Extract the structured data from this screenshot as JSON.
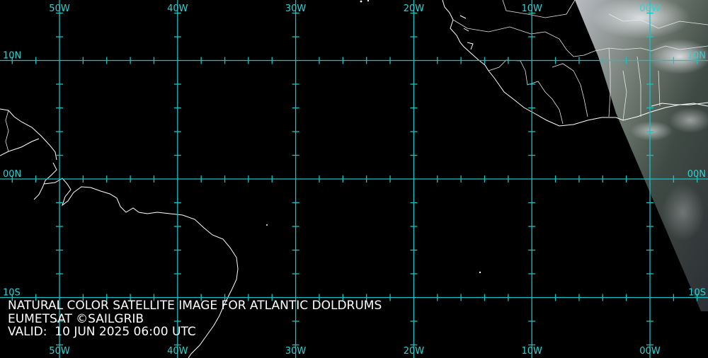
{
  "caption": {
    "title": "NATURAL COLOR SATELLITE IMAGE FOR ATLANTIC DOLDRUMS",
    "credit": "EUMETSAT ©SAILGRIB",
    "valid": "VALID:  10 JUN 2025 06:00 UTC"
  },
  "grid": {
    "longitudes": [
      {
        "deg": -50,
        "label": "50W"
      },
      {
        "deg": -40,
        "label": "40W"
      },
      {
        "deg": -30,
        "label": "30W"
      },
      {
        "deg": -20,
        "label": "20W"
      },
      {
        "deg": -10,
        "label": "10W"
      },
      {
        "deg": 0,
        "label": "00W"
      }
    ],
    "latitudes": [
      {
        "deg": 10,
        "label": "10N"
      },
      {
        "deg": 0,
        "label": "00N"
      },
      {
        "deg": -10,
        "label": "10S"
      }
    ],
    "line_color": "#19c2c2"
  },
  "colors": {
    "background": "#000000",
    "coastline": "#ffffff",
    "label": "#2fd3d3"
  }
}
